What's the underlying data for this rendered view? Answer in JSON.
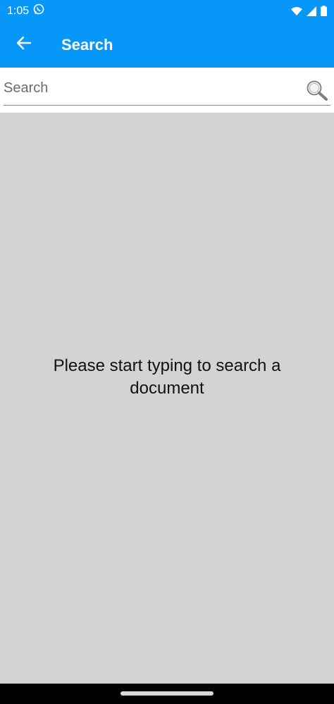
{
  "status_bar": {
    "time": "1:05",
    "icons": [
      "whatsapp-icon",
      "wifi-icon",
      "signal-icon",
      "battery-icon"
    ]
  },
  "app_bar": {
    "title": "Search",
    "back_icon": "arrow-left-icon"
  },
  "search": {
    "placeholder": "Search",
    "value": ""
  },
  "content": {
    "empty_message": "Please start typing to search a document"
  },
  "colors": {
    "primary": "#0797f8",
    "background": "#d4d2d5"
  }
}
